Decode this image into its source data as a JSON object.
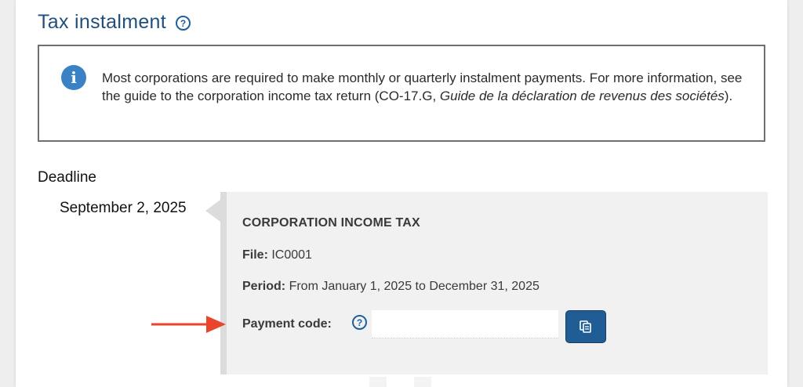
{
  "section": {
    "title": "Tax instalment",
    "help_icon": "question-circle-icon"
  },
  "info": {
    "icon": "info-icon",
    "text_part1": "Most corporations are required to make monthly or quarterly instalment payments. For more information, see the guide to the corporation income tax return (CO-17.G, ",
    "text_italic1": "Guide de la déclaration de revenus des sociétés",
    "text_part2": ")."
  },
  "deadline": {
    "label": "Deadline",
    "date": "September 2, 2025"
  },
  "details": {
    "heading": "CORPORATION INCOME TAX",
    "file_label": "File:",
    "file_value": "IC0001",
    "period_label": "Period:",
    "period_value": "From January 1, 2025 to December 31, 2025",
    "payment_label": "Payment code:",
    "payment_value": "",
    "copy_icon": "copy-icon"
  },
  "colors": {
    "title": "#1f4f7c",
    "accent": "#215d95",
    "info_icon_bg": "#3a82c4",
    "annotation_arrow": "#e8452c"
  }
}
